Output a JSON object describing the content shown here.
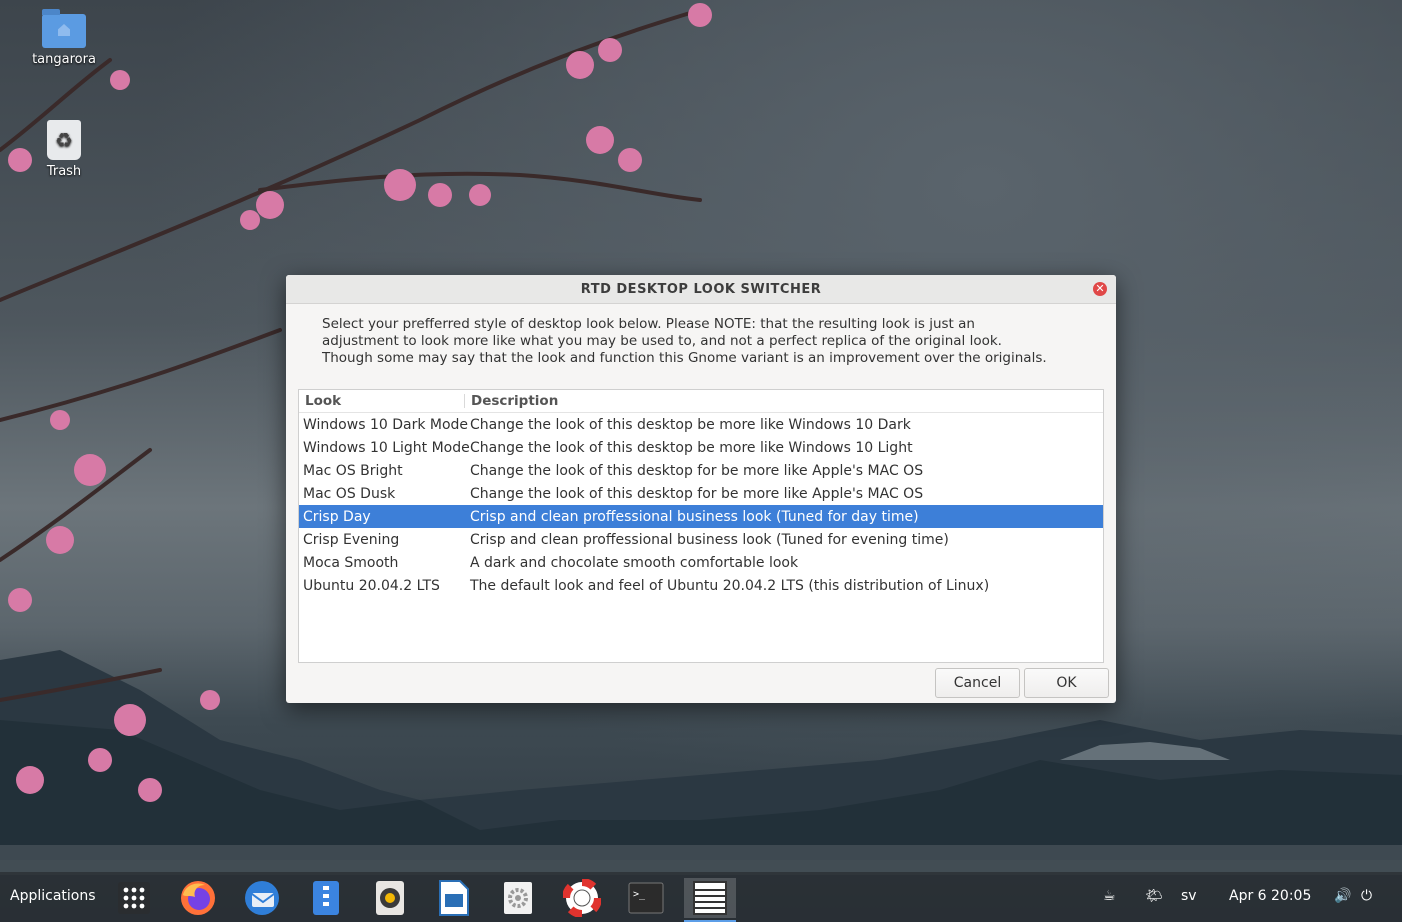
{
  "desktop": {
    "icons": [
      {
        "label": "tangarora",
        "icon": "home-folder-icon"
      },
      {
        "label": "Trash",
        "icon": "trash-icon"
      }
    ]
  },
  "dialog": {
    "title": "RTD DESKTOP LOOK SWITCHER",
    "intro_lines": [
      "Select your prefferred style of desktop look below. Please NOTE: that the resulting look is just an",
      "adjustment to look more like what you may be used to, and not a perfect replica of the original look.",
      "Though some may say that the look and function this Gnome variant is an improvement over the originals."
    ],
    "columns": {
      "look": "Look",
      "description": "Description"
    },
    "rows": [
      {
        "look": "Windows 10 Dark Mode",
        "description": "Change the look of this desktop be more like Windows 10 Dark"
      },
      {
        "look": "Windows 10 Light Mode",
        "description": "Change the look of this desktop be more like Windows 10 Light"
      },
      {
        "look": "Mac OS Bright",
        "description": "Change the look of this desktop for be more like Apple's MAC OS"
      },
      {
        "look": "Mac OS Dusk",
        "description": "Change the look of this desktop for be more like Apple's MAC OS"
      },
      {
        "look": "Crisp Day",
        "description": "Crisp and clean proffessional business look (Tuned for day time)"
      },
      {
        "look": "Crisp Evening",
        "description": "Crisp and clean proffessional business look (Tuned for evening time)"
      },
      {
        "look": "Moca Smooth",
        "description": "A dark and chocolate smooth comfortable look"
      },
      {
        "look": "Ubuntu 20.04.2 LTS",
        "description": "The default look and feel of Ubuntu 20.04.2 LTS (this distribution of Linux)"
      }
    ],
    "selected_row": "Crisp Day",
    "buttons": {
      "cancel": "Cancel",
      "ok": "OK"
    },
    "accent_color": "#3d7fd8"
  },
  "taskbar": {
    "applications_label": "Applications",
    "launchers": [
      "app-grid-icon",
      "firefox-icon",
      "thunderbird-icon",
      "files-icon",
      "rhythmbox-icon",
      "libreoffice-impress-icon",
      "settings-icon",
      "help-icon",
      "terminal-icon",
      "look-switcher-icon"
    ],
    "active_launcher": "look-switcher-icon",
    "tray": {
      "keyboard_layout": "sv",
      "date": "Apr 6",
      "time": "20:05"
    }
  }
}
